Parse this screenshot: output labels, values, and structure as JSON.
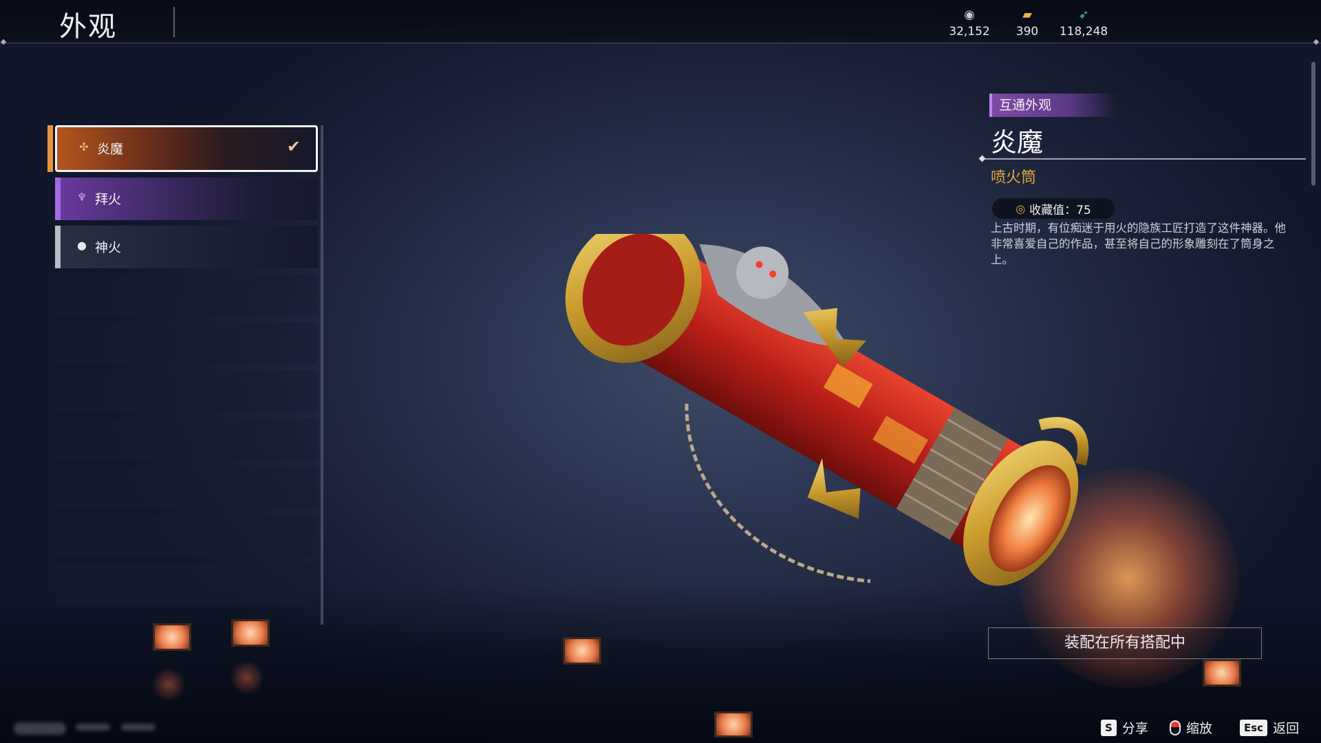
{
  "header": {
    "title": "外观"
  },
  "currencies": [
    {
      "icon": "silver-coin-icon",
      "value": "32,152"
    },
    {
      "icon": "gold-ticket-icon",
      "value": "390"
    },
    {
      "icon": "blue-feather-icon",
      "value": "118,248"
    }
  ],
  "skins": [
    {
      "label": "炎魔",
      "selected": true,
      "rarity_color": "#e4953e",
      "icon": "flame-cross-icon"
    },
    {
      "label": "拜火",
      "selected": false,
      "rarity_color": "#a26ae0",
      "icon": "trident-icon"
    },
    {
      "label": "神火",
      "selected": false,
      "rarity_color": "#b9bcc4",
      "icon": "drop-icon"
    }
  ],
  "detail": {
    "tag": "互通外观",
    "name": "炎魔",
    "category": "喷火筒",
    "collect_label": "收藏值：75",
    "description": "上古时期，有位痴迷于用火的隐族工匠打造了这件神器。他非常喜爱自己的作品，甚至将自己的形象雕刻在了筒身之上。",
    "equip_button": "装配在所有搭配中"
  },
  "footer": {
    "share_key": "S",
    "share_label": "分享",
    "zoom_label": "缩放",
    "back_key": "Esc",
    "back_label": "返回"
  }
}
